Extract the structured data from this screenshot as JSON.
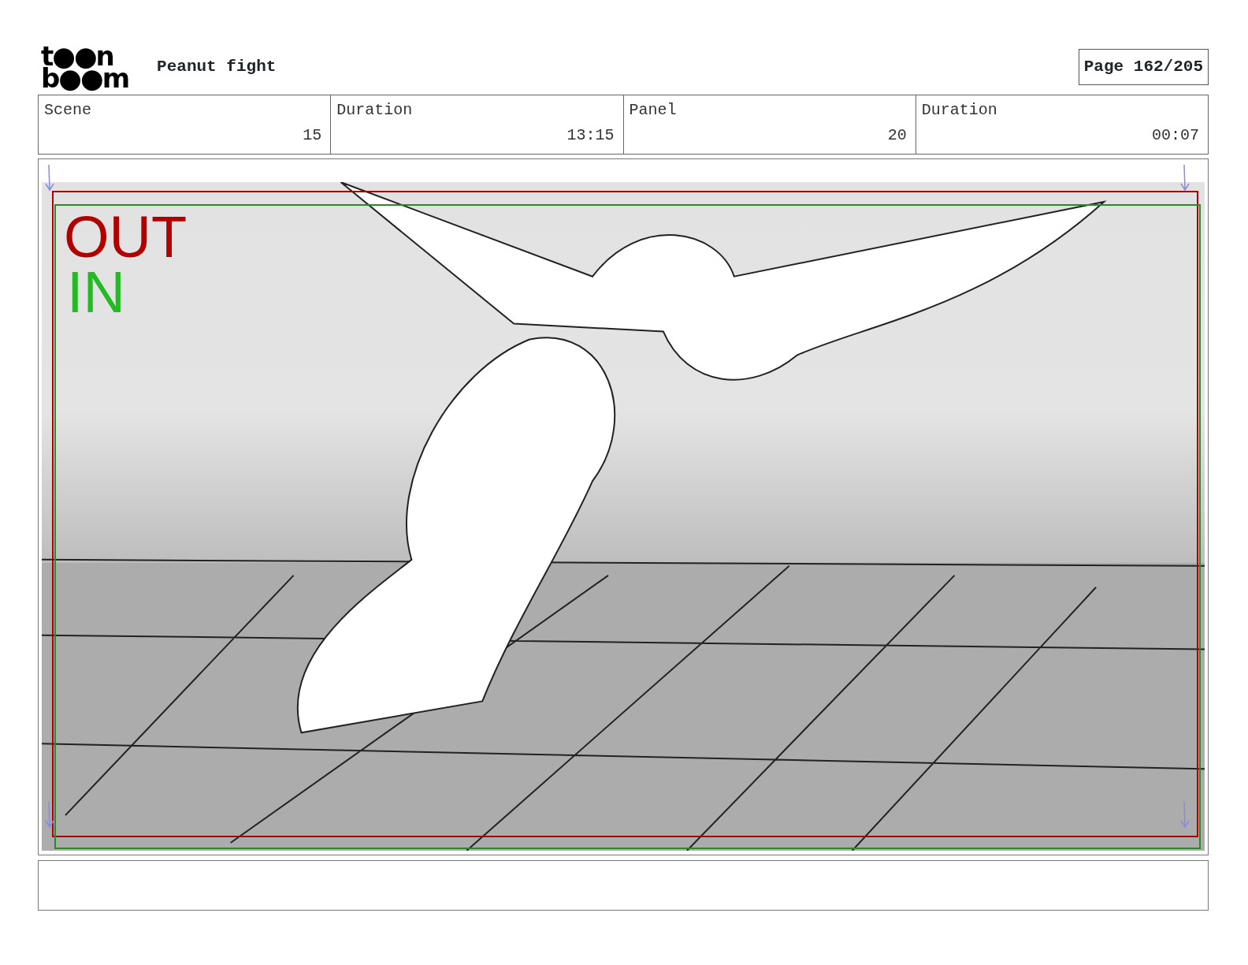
{
  "header": {
    "logo_lines": [
      "t●●n",
      "b●●m"
    ],
    "title": "Peanut fight",
    "page": "Page 162/205"
  },
  "info": [
    {
      "label": "Scene",
      "value": "15"
    },
    {
      "label": "Duration",
      "value": "13:15"
    },
    {
      "label": "Panel",
      "value": "20"
    },
    {
      "label": "Duration",
      "value": "00:07"
    }
  ],
  "panel": {
    "frame_labels": [
      {
        "text": "OUT",
        "color": "#b00000"
      },
      {
        "text": "IN",
        "color": "#22bb22"
      }
    ]
  }
}
